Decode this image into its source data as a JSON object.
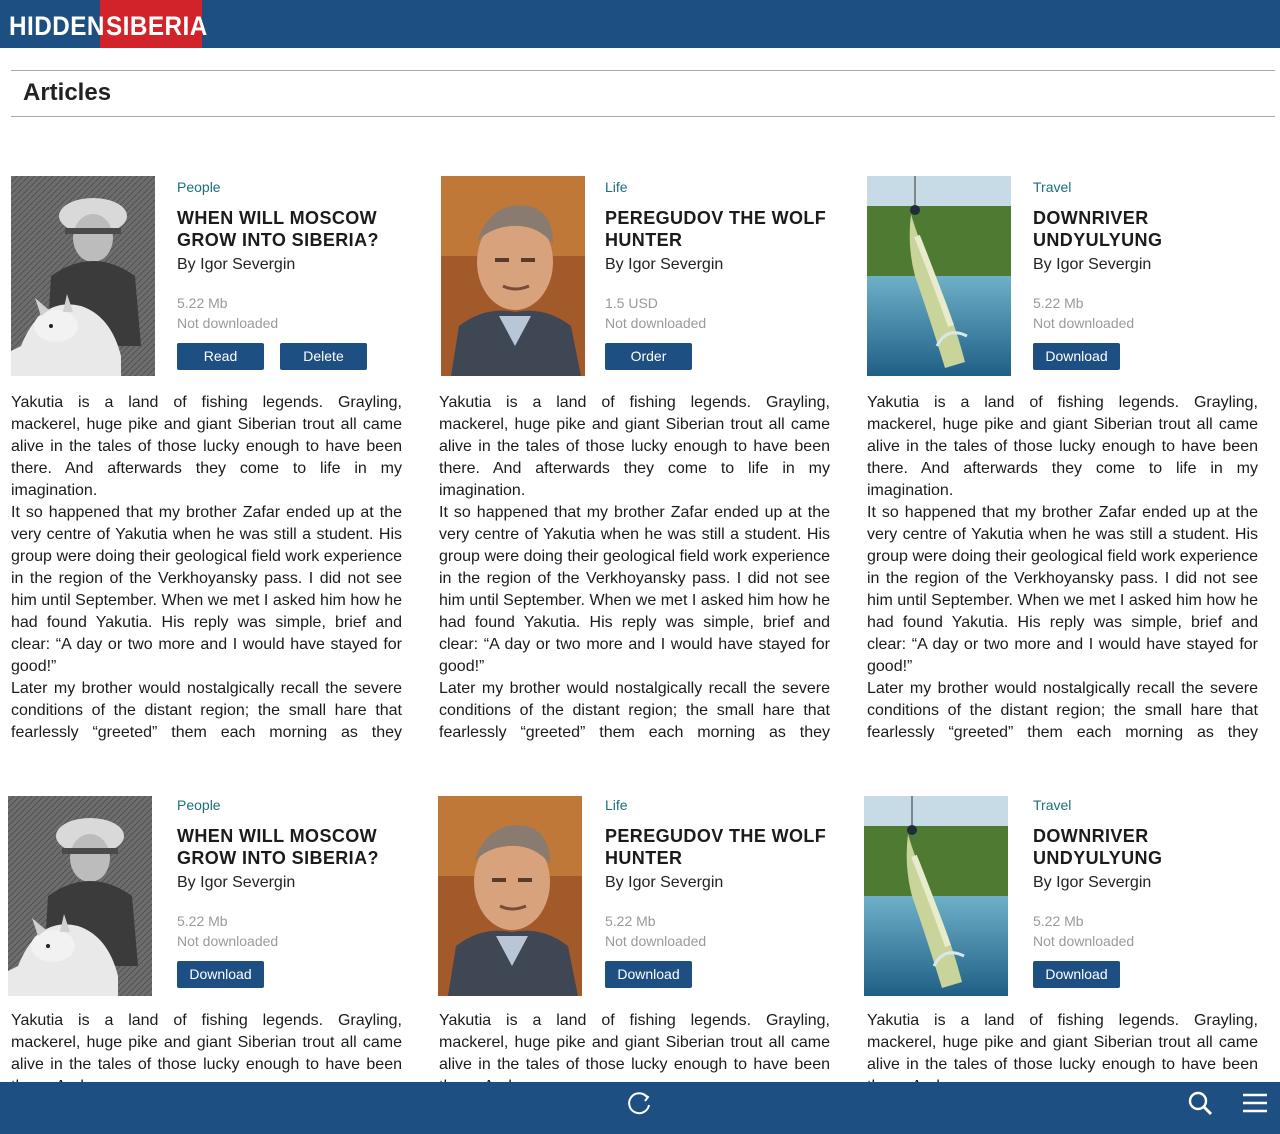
{
  "header": {
    "logo_left": "HIDDEN",
    "logo_right": "SIBERIA",
    "colors": {
      "bar": "#1e4f82",
      "logo_accent": "#d2232a"
    }
  },
  "section": {
    "title": "Articles"
  },
  "articles": [
    {
      "category": "People",
      "title": "WHEN WILL MOSCOW GROW INTO SIBERIA?",
      "author": "By Igor Severgin",
      "size": "5.22 Mb",
      "status": "Not downloaded",
      "buttons": [
        "Read",
        "Delete"
      ],
      "image": "man-with-wolf-photo",
      "paragraphs": [
        "Yakutia is a land of fishing legends. Grayling, mackerel, huge pike and giant Siberian trout all came alive in the tales of those lucky enough to have been there. And afterwards they come to life in my imagination.",
        "It so happened that my brother Zafar ended up at the very centre of Yakutia when he was still a student. His group were doing their geological field work experience in the region of the Verkhoyansky pass. I did not see him until September. When we met I asked him how he had found Yakutia. His reply was simple, brief and clear: “A day or two more and I would have stayed for good!”",
        "Later my brother would nostalgically recall the severe conditions of the distant region; the small hare that fearlessly “greeted” them each morning as they crawled out of their tents; the huge grayling that pushed"
      ]
    },
    {
      "category": "Life",
      "title": "PEREGUDOV THE WOLF HUNTER",
      "author": "By Igor Severgin",
      "size": "1.5 USD",
      "status": "Not downloaded",
      "buttons": [
        "Order"
      ],
      "image": "man-portrait-photo",
      "paragraphs": [
        "Yakutia is a land of fishing legends. Grayling, mackerel, huge pike and giant Siberian trout all came alive in the tales of those lucky enough to have been there. And afterwards they come to life in my imagination.",
        "It so happened that my brother Zafar ended up at the very centre of Yakutia when he was still a student. His group were doing their geological field work experience in the region of the Verkhoyansky pass. I did not see him until September. When we met I asked him how he had found Yakutia. His reply was simple, brief and clear: “A day or two more and I would have stayed for good!”",
        "Later my brother would nostalgically recall the severe conditions of the distant region; the small hare that fearlessly “greeted” them each morning as they crawled out of their tents; the huge grayling that pushed"
      ]
    },
    {
      "category": "Travel",
      "title": "DOWNRIVER UNDYULYUNG",
      "author": "By Igor Severgin",
      "size": "5.22 Mb",
      "status": "Not downloaded",
      "buttons": [
        "Download"
      ],
      "image": "pike-fish-photo",
      "paragraphs": [
        "Yakutia is a land of fishing legends. Grayling, mackerel, huge pike and giant Siberian trout all came alive in the tales of those lucky enough to have been there. And afterwards they come to life in my imagination.",
        "It so happened that my brother Zafar ended up at the very centre of Yakutia when he was still a student. His group were doing their geological field work experience in the region of the Verkhoyansky pass. I did not see him until September. When we met I asked him how he had found Yakutia. His reply was simple, brief and clear: “A day or two more and I would have stayed for good!”",
        "Later my brother would nostalgically recall the severe conditions of the distant region; the small hare that fearlessly “greeted” them each morning as they crawled out of their tents; the huge grayling that pushed"
      ]
    },
    {
      "category": "People",
      "title": "WHEN WILL MOSCOW GROW INTO SIBERIA?",
      "author": "By Igor Severgin",
      "size": "5.22 Mb",
      "status": "Not downloaded",
      "buttons": [
        "Download"
      ],
      "image": "man-with-wolf-photo",
      "paragraphs": [
        "Yakutia is a land of fishing legends. Grayling, mackerel, huge pike and giant Siberian trout all came alive in the tales of those lucky enough to have been there. And"
      ]
    },
    {
      "category": "Life",
      "title": "PEREGUDOV THE WOLF HUNTER",
      "author": "By Igor Severgin",
      "size": "5.22 Mb",
      "status": "Not downloaded",
      "buttons": [
        "Download"
      ],
      "image": "man-portrait-photo",
      "paragraphs": [
        "Yakutia is a land of fishing legends. Grayling, mackerel, huge pike and giant Siberian trout all came alive in the tales of those lucky enough to have been there. And"
      ]
    },
    {
      "category": "Travel",
      "title": "DOWNRIVER UNDYULYUNG",
      "author": "By Igor Severgin",
      "size": "5.22 Mb",
      "status": "Not downloaded",
      "buttons": [
        "Download"
      ],
      "image": "pike-fish-photo",
      "paragraphs": [
        "Yakutia is a land of fishing legends. Grayling, mackerel, huge pike and giant Siberian trout all came alive in the tales of those lucky enough to have been there. And"
      ]
    }
  ],
  "footer": {
    "items": [
      {
        "icon": "refresh-icon"
      },
      {
        "icon": "search-icon"
      },
      {
        "icon": "menu-icon"
      }
    ]
  }
}
